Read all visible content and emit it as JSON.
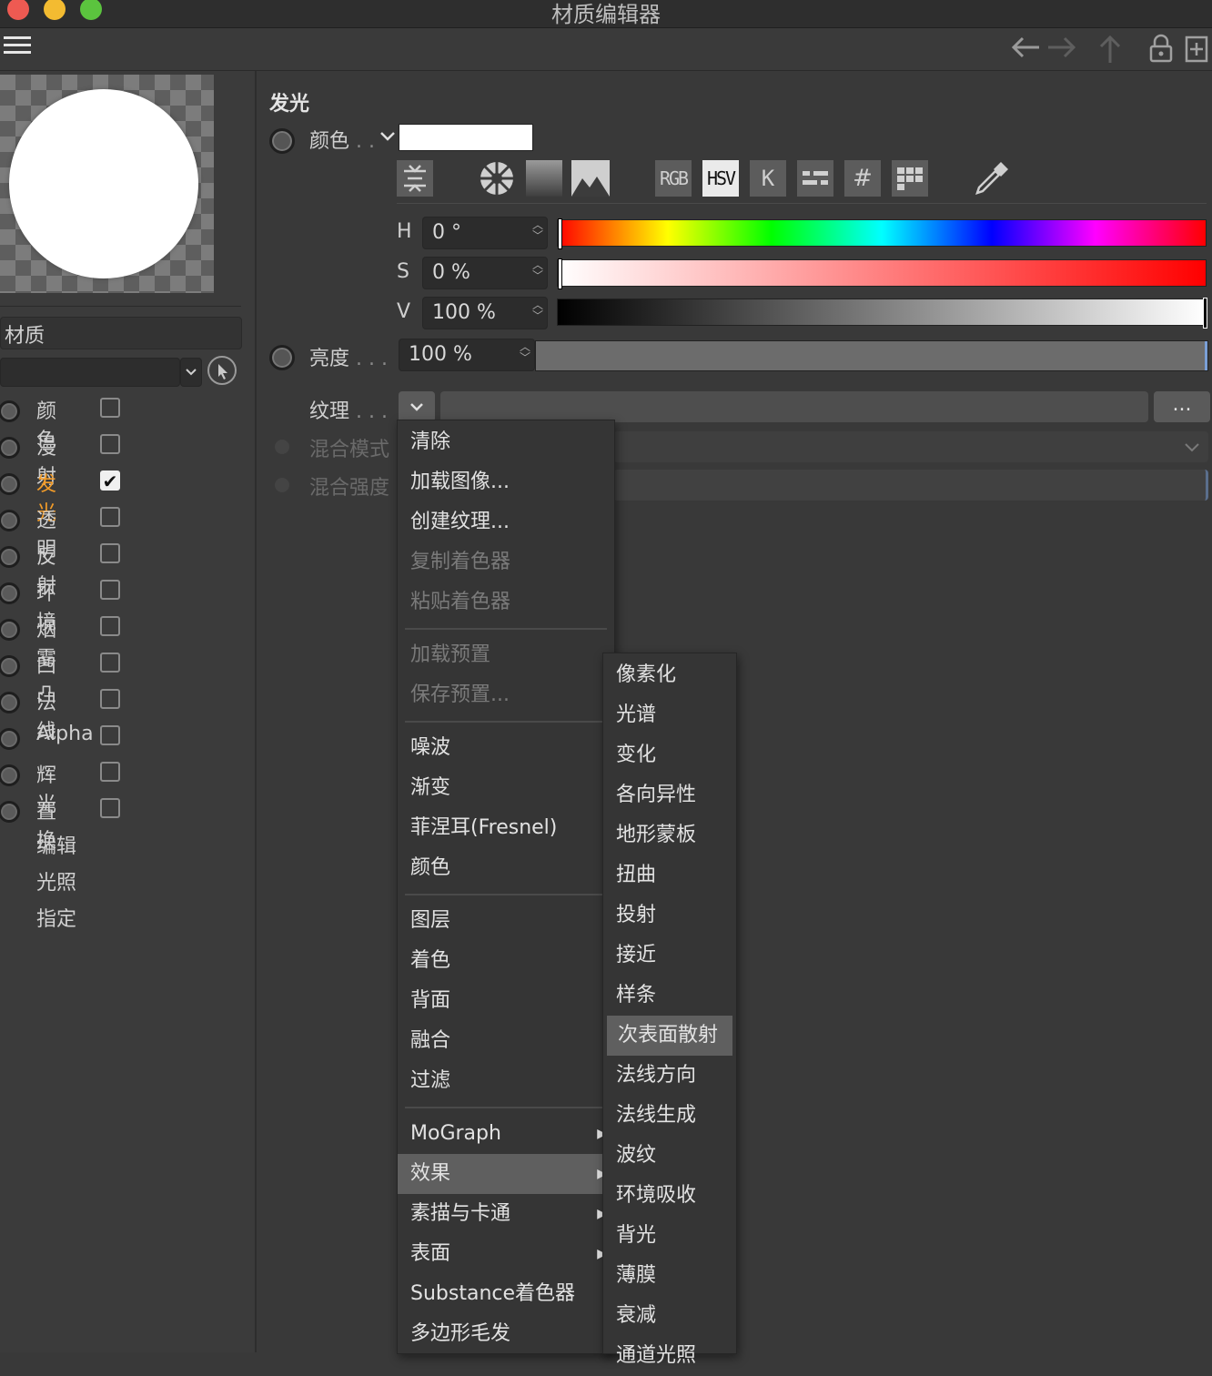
{
  "window": {
    "title": "材质编辑器",
    "traffic_colors": [
      "#ee5a52",
      "#f3bb31",
      "#5bc43e"
    ]
  },
  "toolbar": {
    "icons": [
      "hamburger-icon",
      "arrow-left-icon",
      "arrow-right-icon",
      "arrow-up-icon",
      "lock-icon",
      "new-window-icon"
    ]
  },
  "left": {
    "material_label": "材质",
    "channels": [
      {
        "label": "颜色",
        "checked": false
      },
      {
        "label": "漫射",
        "checked": false
      },
      {
        "label": "发光",
        "checked": true,
        "active": true
      },
      {
        "label": "透明",
        "checked": false
      },
      {
        "label": "反射",
        "checked": false
      },
      {
        "label": "环境",
        "checked": false
      },
      {
        "label": "烟雾",
        "checked": false
      },
      {
        "label": "凹凸",
        "checked": false
      },
      {
        "label": "法线",
        "checked": false
      },
      {
        "label": "Alpha",
        "checked": false
      },
      {
        "label": "辉光",
        "checked": false
      },
      {
        "label": "置换",
        "checked": false
      }
    ],
    "extras": [
      "编辑",
      "光照",
      "指定"
    ]
  },
  "section": {
    "title": "发光"
  },
  "color": {
    "label": "颜色",
    "swatch": "#ffffff",
    "mode_buttons": [
      "RGB",
      "HSV",
      "K",
      "#"
    ],
    "h": {
      "label": "H",
      "value": "0 °",
      "fraction": 0.0
    },
    "s": {
      "label": "S",
      "value": "0 %",
      "fraction": 0.0
    },
    "v": {
      "label": "V",
      "value": "100 %",
      "fraction": 1.0
    }
  },
  "brightness": {
    "label": "亮度",
    "value": "100 %",
    "fraction": 1.0
  },
  "texture": {
    "label": "纹理",
    "more_button": "..."
  },
  "blend_mode": {
    "label": "混合模式"
  },
  "blend_strength": {
    "label": "混合强度"
  },
  "menu": {
    "group1": [
      "清除",
      "加载图像...",
      "创建纹理...",
      "复制着色器",
      "粘贴着色器"
    ],
    "group1_disabled": [
      false,
      false,
      false,
      true,
      true
    ],
    "group2": [
      "加载预置",
      "保存预置..."
    ],
    "group3": [
      "噪波",
      "渐变",
      "菲涅耳(Fresnel)",
      "颜色"
    ],
    "group4": [
      "图层",
      "着色",
      "背面",
      "融合",
      "过滤"
    ],
    "group5": [
      "MoGraph",
      "效果",
      "素描与卡通",
      "表面",
      "Substance着色器",
      "多边形毛发"
    ],
    "group5_has_submenu": [
      true,
      true,
      true,
      true,
      false,
      false
    ],
    "highlighted": "效果"
  },
  "submenu": {
    "items": [
      "像素化",
      "光谱",
      "变化",
      "各向异性",
      "地形蒙板",
      "扭曲",
      "投射",
      "接近",
      "样条",
      "次表面散射",
      "法线方向",
      "法线生成",
      "波纹",
      "环境吸收",
      "背光",
      "薄膜",
      "衰减",
      "通道光照"
    ],
    "highlighted": "次表面散射"
  }
}
